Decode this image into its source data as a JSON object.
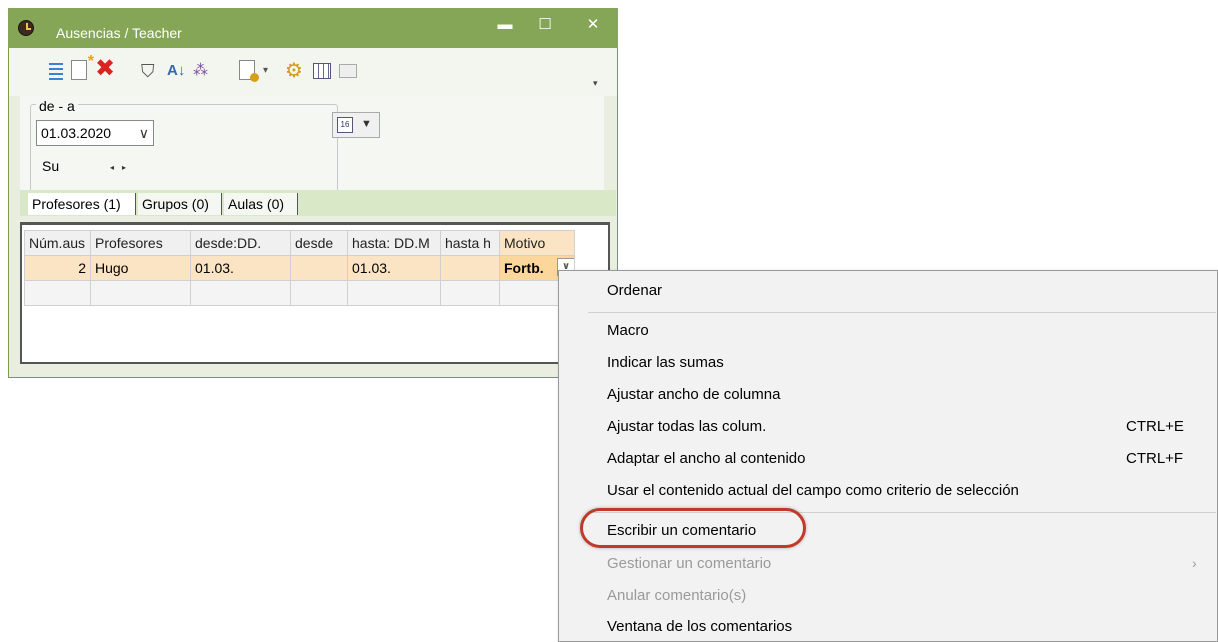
{
  "window": {
    "title": "Ausencias / Teacher",
    "controls": {
      "minimize": "▬",
      "maximize": "☐",
      "close": "✕"
    }
  },
  "toolbar": {
    "icons": [
      "list-icon",
      "new-record-icon",
      "delete-icon",
      "filter-icon",
      "sort-icon",
      "share-icon",
      "document-settings-icon",
      "dropdown-arrow-icon",
      "gear-icon",
      "grid-icon",
      "calendar-disabled-icon"
    ]
  },
  "filter": {
    "group_label": "de - a",
    "date_value": "01.03.2020",
    "date_chevron": "∨",
    "day": "Su",
    "nav": "◂▸",
    "calendar_label": "16"
  },
  "tabs": [
    {
      "label": "Profesores (1)",
      "active": true
    },
    {
      "label": "Grupos (0)",
      "active": false
    },
    {
      "label": "Aulas (0)",
      "active": false
    }
  ],
  "grid": {
    "headers": [
      "Núm.aus",
      "Profesores",
      "desde:DD.",
      "desde",
      "hasta: DD.M",
      "hasta h",
      "Motivo"
    ],
    "rows": [
      [
        "2",
        "Hugo",
        "01.03.",
        "",
        "01.03.",
        "",
        "Fortb."
      ]
    ]
  },
  "context_menu": {
    "items": [
      {
        "label": "Ordenar",
        "shortcut": "",
        "disabled": false
      },
      {
        "label": "Macro",
        "shortcut": "",
        "disabled": false
      },
      {
        "label": "Indicar las sumas",
        "shortcut": "",
        "disabled": false
      },
      {
        "label": "Ajustar ancho de columna",
        "shortcut": "",
        "disabled": false
      },
      {
        "label": "Ajustar todas las colum.",
        "shortcut": "CTRL+E",
        "disabled": false
      },
      {
        "label": "Adaptar el ancho al contenido",
        "shortcut": "CTRL+F",
        "disabled": false
      },
      {
        "label": "Usar el contenido actual del campo como criterio de selección",
        "shortcut": "",
        "disabled": false
      },
      {
        "label": "Escribir un comentario",
        "shortcut": "",
        "disabled": false,
        "highlighted": true
      },
      {
        "label": "Gestionar un comentario",
        "shortcut": "",
        "disabled": true,
        "submenu": "›"
      },
      {
        "label": "Anular comentario(s)",
        "shortcut": "",
        "disabled": true
      },
      {
        "label": "Ventana de los comentarios",
        "shortcut": "",
        "disabled": false
      }
    ]
  },
  "colors": {
    "titlebar": "#86a657",
    "tab_strip": "#d9e9c8",
    "selected_row": "#fbe4c4",
    "highlight_ring": "#c0392b"
  }
}
